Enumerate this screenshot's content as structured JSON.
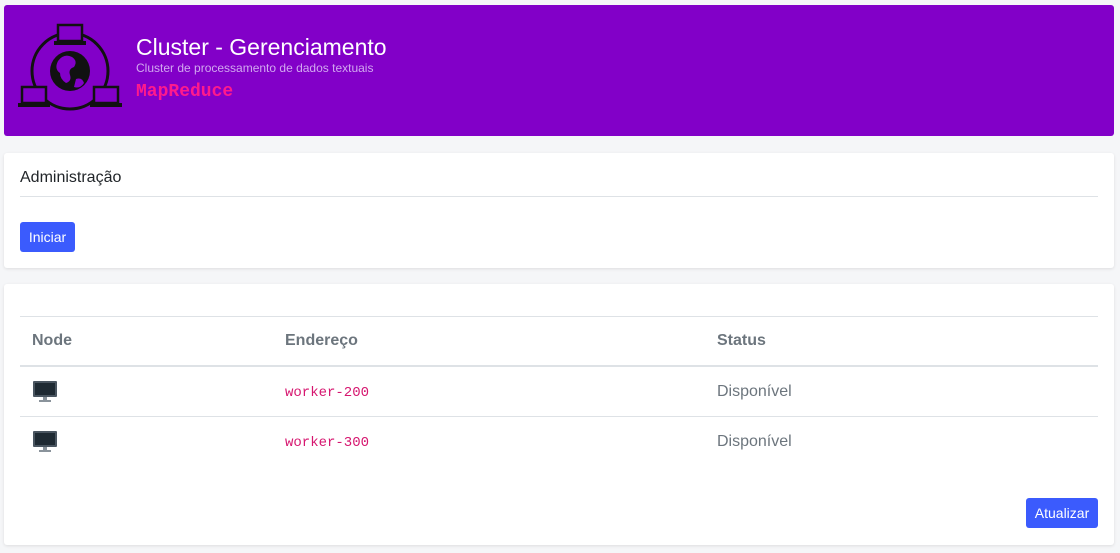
{
  "header": {
    "title": "Cluster - Gerenciamento",
    "subtitle": "Cluster de processamento de dados textuais",
    "tag": "MapReduce",
    "logo_icon": "cluster-network-globe-icon",
    "background_color": "#8200c8",
    "tag_color": "#ff1a8c"
  },
  "admin": {
    "title": "Administração",
    "start_label": "Iniciar",
    "button_color": "#3b5bfd"
  },
  "nodes": {
    "columns": [
      "Node",
      "Endereço",
      "Status"
    ],
    "rows": [
      {
        "icon": "monitor-icon",
        "address": "worker-200",
        "status": "Disponível"
      },
      {
        "icon": "monitor-icon",
        "address": "worker-300",
        "status": "Disponível"
      }
    ],
    "refresh_label": "Atualizar",
    "address_color": "#d6166f"
  }
}
